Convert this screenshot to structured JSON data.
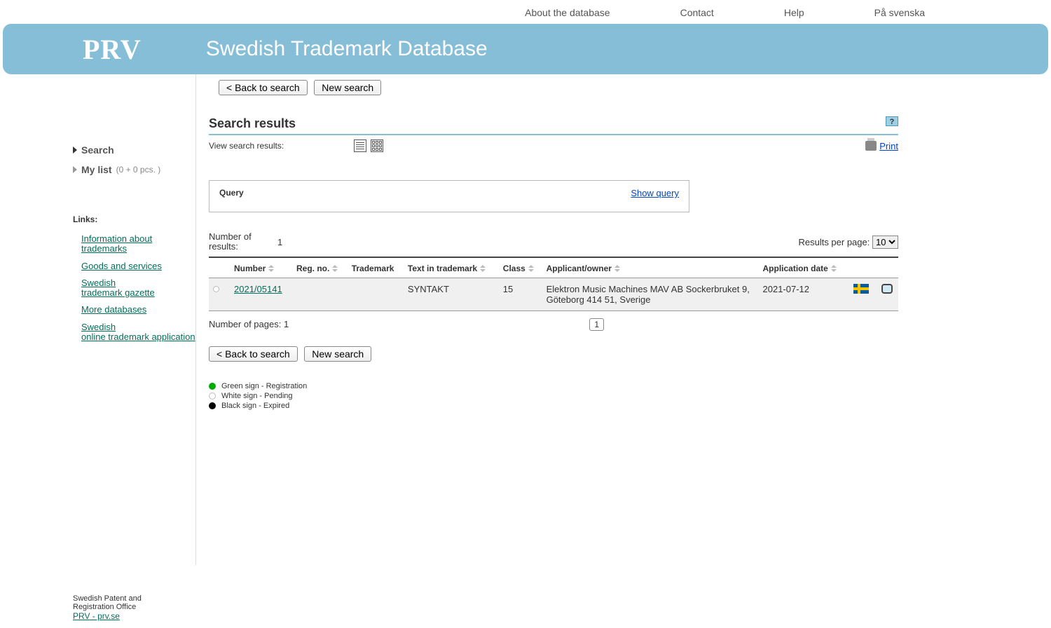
{
  "topnav": {
    "about": "About the database",
    "contact": "Contact",
    "help": "Help",
    "swedish": "På svenska"
  },
  "banner": {
    "logo": "PRV",
    "title": "Swedish Trademark Database"
  },
  "sidebar": {
    "search": "Search",
    "mylist": "My list",
    "mylist_count": "(0 + 0 pcs. )",
    "links_header": "Links:",
    "links": {
      "info": "Information about trademarks",
      "goods": "Goods and services",
      "gazette1": "Swedish",
      "gazette2": "trademark gazette",
      "more": "More databases",
      "online1": "Swedish",
      "online2": "online trademark application"
    }
  },
  "buttons": {
    "back": "< Back to search",
    "newsearch": "New search"
  },
  "results": {
    "heading": "Search results",
    "help": "?",
    "view_label": "View search results:",
    "print": "Print",
    "query_label": "Query",
    "show_query": "Show query",
    "num_results_label": "Number of results:",
    "num_results": "1",
    "rpp_label": "Results per page:",
    "rpp_value": "10",
    "columns": {
      "number": "Number",
      "regno": "Reg. no.",
      "trademark": "Trademark",
      "text": "Text in trademark",
      "class": "Class",
      "applicant": "Applicant/owner",
      "appdate": "Application date"
    },
    "rows": [
      {
        "number": "2021/05141",
        "regno": "",
        "trademark": "",
        "text": "SYNTAKT",
        "class": "15",
        "applicant": "Elektron Music Machines MAV AB Sockerbruket 9, Göteborg 414 51, Sverige",
        "appdate": "2021-07-12"
      }
    ],
    "num_pages_label": "Number of pages: 1",
    "page_current": "1"
  },
  "legend": {
    "green": "Green sign - Registration",
    "white": "White sign - Pending",
    "black": "Black sign - Expired"
  },
  "footer": {
    "org1": "Swedish Patent and",
    "org2": "Registration Office",
    "link": "PRV - prv.se"
  }
}
